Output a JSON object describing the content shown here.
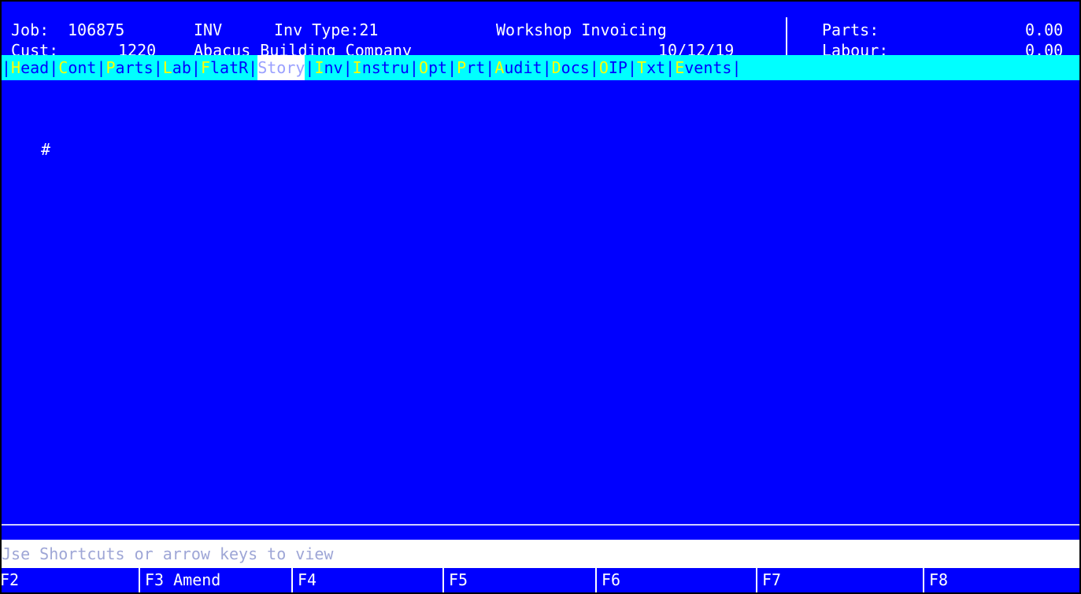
{
  "header": {
    "job_label": "Job:",
    "job_number": "106875",
    "doc_type": "INV",
    "inv_type": "Inv Type:21",
    "module_title": "Workshop Invoicing",
    "cust_label": "Cust:",
    "cust_number": "1220",
    "cust_name": "Abacus Building Company",
    "date": "10/12/19",
    "parts_label": "Parts:",
    "parts_value": "0.00",
    "labour_label": "Labour:",
    "labour_value": "0.00"
  },
  "tabs": [
    {
      "hotkey": "H",
      "rest": "ead"
    },
    {
      "hotkey": "C",
      "rest": "ont"
    },
    {
      "hotkey": "P",
      "rest": "arts"
    },
    {
      "hotkey": "L",
      "rest": "ab"
    },
    {
      "hotkey": "F",
      "rest": "latR"
    },
    {
      "hotkey": "S",
      "rest": "tory"
    },
    {
      "hotkey": "I",
      "rest": "nv"
    },
    {
      "hotkey": "I",
      "rest": "nstru"
    },
    {
      "hotkey": "O",
      "rest": "pt"
    },
    {
      "hotkey": "P",
      "rest": "rt"
    },
    {
      "hotkey": "A",
      "rest": "udit"
    },
    {
      "hotkey": "D",
      "rest": "ocs"
    },
    {
      "hotkey": "O",
      "rest": "IP"
    },
    {
      "hotkey": "T",
      "rest": "xt"
    },
    {
      "hotkey": "E",
      "rest": "vents"
    }
  ],
  "content": {
    "marker": "#"
  },
  "status": {
    "message": "Jse Shortcuts or arrow keys to view"
  },
  "function_keys": [
    {
      "key": "F2",
      "label": ""
    },
    {
      "key": "F3",
      "label": "Amend"
    },
    {
      "key": "F4",
      "label": ""
    },
    {
      "key": "F5",
      "label": ""
    },
    {
      "key": "F6",
      "label": ""
    },
    {
      "key": "F7",
      "label": ""
    },
    {
      "key": "F8",
      "label": ""
    }
  ],
  "colors": {
    "screen_bg": "#0000ff",
    "tab_bar_bg": "#00ffff",
    "hotkey": "#ffff00",
    "active_tab_bg": "#ffffff",
    "text": "#ffffff"
  }
}
